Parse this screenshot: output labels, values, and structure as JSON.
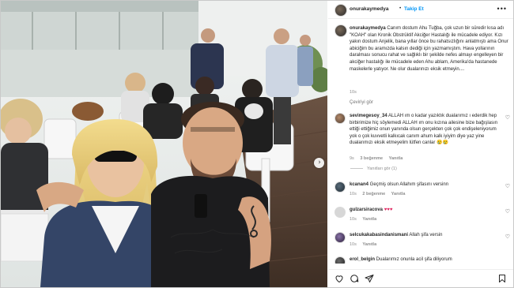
{
  "post": {
    "username": "onurakaymedya",
    "follow_label": "Takip Et",
    "separator": "•",
    "more_label": "•••",
    "caption_prefix": " Canım dostum Ahu Tuğba, çok uzun bir süredir kısa adı \"KOAH\" olan Kronik Obstrüktif Akciğer Hastalığı ile mücadele ediyor. Kızı yakın dostum Anjelik, bana yıllar önce bu rahatsızlığını anlatmıştı ama Onur abiciğim bu aramızda kalsın dediği için yazmamıştım. Hava yollarının daralması sonucu rahat ve sağlıklı bir şekilde nefes almayı engelleyen bir akciğer hastalığı ile mücadele eden Ahu ablam, Amerika'da hastanede maskelerle yatıyor. Ne olur dualarınızı eksik etmeyin....",
    "caption_time": "10s",
    "see_translation": "Çeviriyi gör"
  },
  "comments": [
    {
      "username": "sevimegesoy_34",
      "text": " ALLAH ım o kadar yazıktık dualarımız ı ederdik hep birbirimize hiç söylemedi ALLAH ım onu kızına ailesine bize bağışlasın ettiği ettiğimiz onun yanında olsun gerçekten çok çok endişeleniyorum yok o çok kuvvetli kalkıcak canım ahum kalk iyiyim diye yaz yine dualarımızı eksik etmeyelim lütfen canlar ",
      "emoji": "😢😢",
      "time": "9s",
      "likes": "3 beğenme",
      "reply": "Yanıtla",
      "view_replies": "Yanıtları gör (1)"
    },
    {
      "username": "kcanan4",
      "text": " Geçmiş olsun Allahım şifasını versinn",
      "time": "10s",
      "likes": "2 beğenme",
      "reply": "Yanıtla"
    },
    {
      "username": "gulzarsiracova",
      "text": " ",
      "emoji": "♥♥♥",
      "time": "10s",
      "likes": "",
      "reply": "Yanıtla"
    },
    {
      "username": "selcukakabasindanismani",
      "text": " Allah şifa versin",
      "time": "10s",
      "likes": "",
      "reply": "Yanıtla"
    },
    {
      "username": "erol_belgin",
      "text": " Dualarımız onunla acil şifa diliyorum",
      "time": "",
      "likes": "",
      "reply": ""
    }
  ],
  "icons": {
    "heart": "heart-icon",
    "comment": "comment-icon",
    "share": "share-icon",
    "save": "bookmark-icon",
    "next": "chevron-right-icon"
  },
  "colors": {
    "accent": "#0095f6",
    "text": "#262626",
    "muted": "#8e8e8e"
  }
}
